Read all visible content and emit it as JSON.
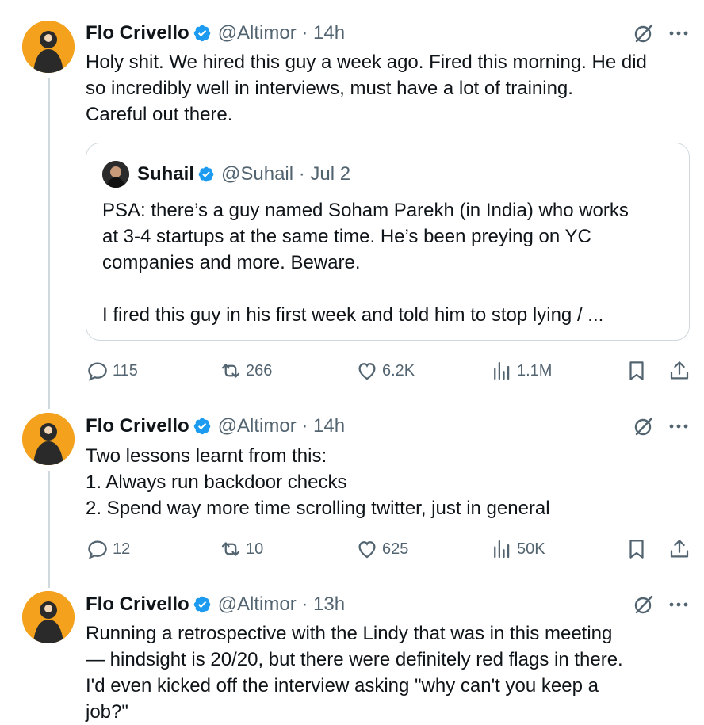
{
  "tweets": [
    {
      "name": "Flo Crivello",
      "handle": "@Altimor · 14h",
      "text": [
        "Holy shit. We hired this guy a week ago. Fired this morning. He did",
        "so incredibly well in interviews, must have a lot of training.",
        "Careful out there."
      ],
      "quote": {
        "name": "Suhail",
        "handle": "@Suhail · Jul 2",
        "text": [
          "PSA: there’s a guy named Soham Parekh (in India) who works",
          "at 3-4 startups at the same time. He’s been preying on YC",
          "companies and more. Beware."
        ],
        "text2": "I fired this guy in his first week and told him to stop lying / ..."
      },
      "stats": {
        "replies": "115",
        "reposts": "266",
        "likes": "6.2K",
        "views": "1.1M"
      }
    },
    {
      "name": "Flo Crivello",
      "handle": "@Altimor · 14h",
      "text": [
        "Two lessons learnt from this:",
        "1. Always run backdoor checks",
        "2. Spend way more time scrolling twitter, just in general"
      ],
      "stats": {
        "replies": "12",
        "reposts": "10",
        "likes": "625",
        "views": "50K"
      }
    },
    {
      "name": "Flo Crivello",
      "handle": "@Altimor · 13h",
      "text": [
        "Running a retrospective with the Lindy that was in this meeting",
        "— hindsight is 20/20, but there were definitely red flags in there.",
        "I'd even kicked off the interview asking \"why can't you keep a",
        "job?\""
      ]
    }
  ],
  "icons": {
    "verified": "verified-badge-icon",
    "grok": "grok-icon",
    "more": "more-icon",
    "reply": "reply-icon",
    "repost": "repost-icon",
    "like": "like-icon",
    "views": "views-icon",
    "bookmark": "bookmark-icon",
    "share": "share-icon"
  },
  "colors": {
    "verified": "#1d9bf0",
    "text": "#0f1419",
    "secondary": "#536471",
    "border": "#cfd9de",
    "avatar_bg": "#f4a21d"
  }
}
